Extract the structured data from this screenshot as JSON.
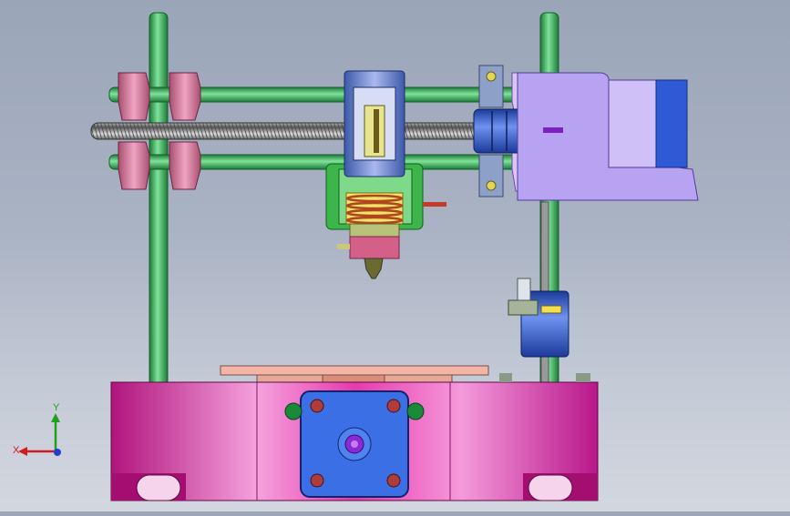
{
  "viewport": {
    "model": "3d-printer-assembly",
    "view": "front"
  },
  "triad": {
    "x_label": "X",
    "y_label": "Y"
  },
  "colors": {
    "frame_rod": "#2fa34e",
    "base": "#e02aa8",
    "clamp": "#d07a9c",
    "carriage": "#5a78c8",
    "motor": "#b8a3f2",
    "coupler": "#2d57c8",
    "stepper_face": "#3b6fe6",
    "build_plate": "#f3b6a6",
    "hotend_holder": "#3cb54a",
    "heater_block": "#d4608a"
  }
}
